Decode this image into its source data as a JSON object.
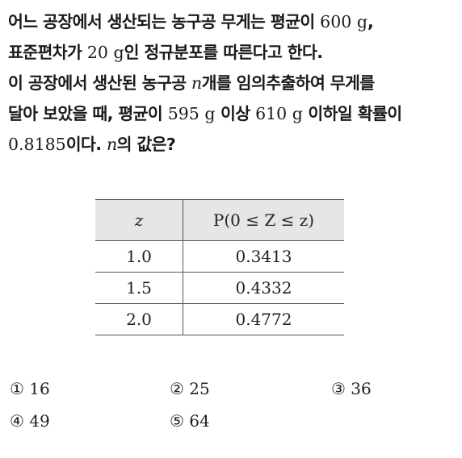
{
  "problem": {
    "lines": [
      [
        {
          "t": "text",
          "v": "어느 공장에서 생산되는 농구공 무게는 평균이 "
        },
        {
          "t": "num",
          "v": "600 g"
        },
        {
          "t": "text",
          "v": ","
        }
      ],
      [
        {
          "t": "text",
          "v": "표준편차가 "
        },
        {
          "t": "num",
          "v": "20 g"
        },
        {
          "t": "text",
          "v": "인 정규분포를 따른다고 한다."
        }
      ],
      [
        {
          "t": "text",
          "v": "이 공장에서 생산된 농구공 "
        },
        {
          "t": "var",
          "v": "n"
        },
        {
          "t": "text",
          "v": "개를 임의추출하여 무게를"
        }
      ],
      [
        {
          "t": "text",
          "v": "달아 보았을 때, 평균이 "
        },
        {
          "t": "num",
          "v": "595 g"
        },
        {
          "t": "text",
          "v": " 이상 "
        },
        {
          "t": "num",
          "v": "610 g"
        },
        {
          "t": "text",
          "v": " 이하일 확률이"
        }
      ],
      [
        {
          "t": "num",
          "v": "0.8185"
        },
        {
          "t": "text",
          "v": "이다. "
        },
        {
          "t": "var",
          "v": "n"
        },
        {
          "t": "text",
          "v": "의 값은?"
        }
      ]
    ]
  },
  "table": {
    "header": {
      "z": "z",
      "prob": "P(0 ≤ Z ≤ z)"
    },
    "rows": [
      {
        "z": "1.0",
        "p": "0.3413"
      },
      {
        "z": "1.5",
        "p": "0.4332"
      },
      {
        "z": "2.0",
        "p": "0.4772"
      }
    ]
  },
  "choices": [
    {
      "label": "① 16"
    },
    {
      "label": "② 25"
    },
    {
      "label": "③ 36"
    },
    {
      "label": "④ 49"
    },
    {
      "label": "⑤ 64"
    }
  ]
}
